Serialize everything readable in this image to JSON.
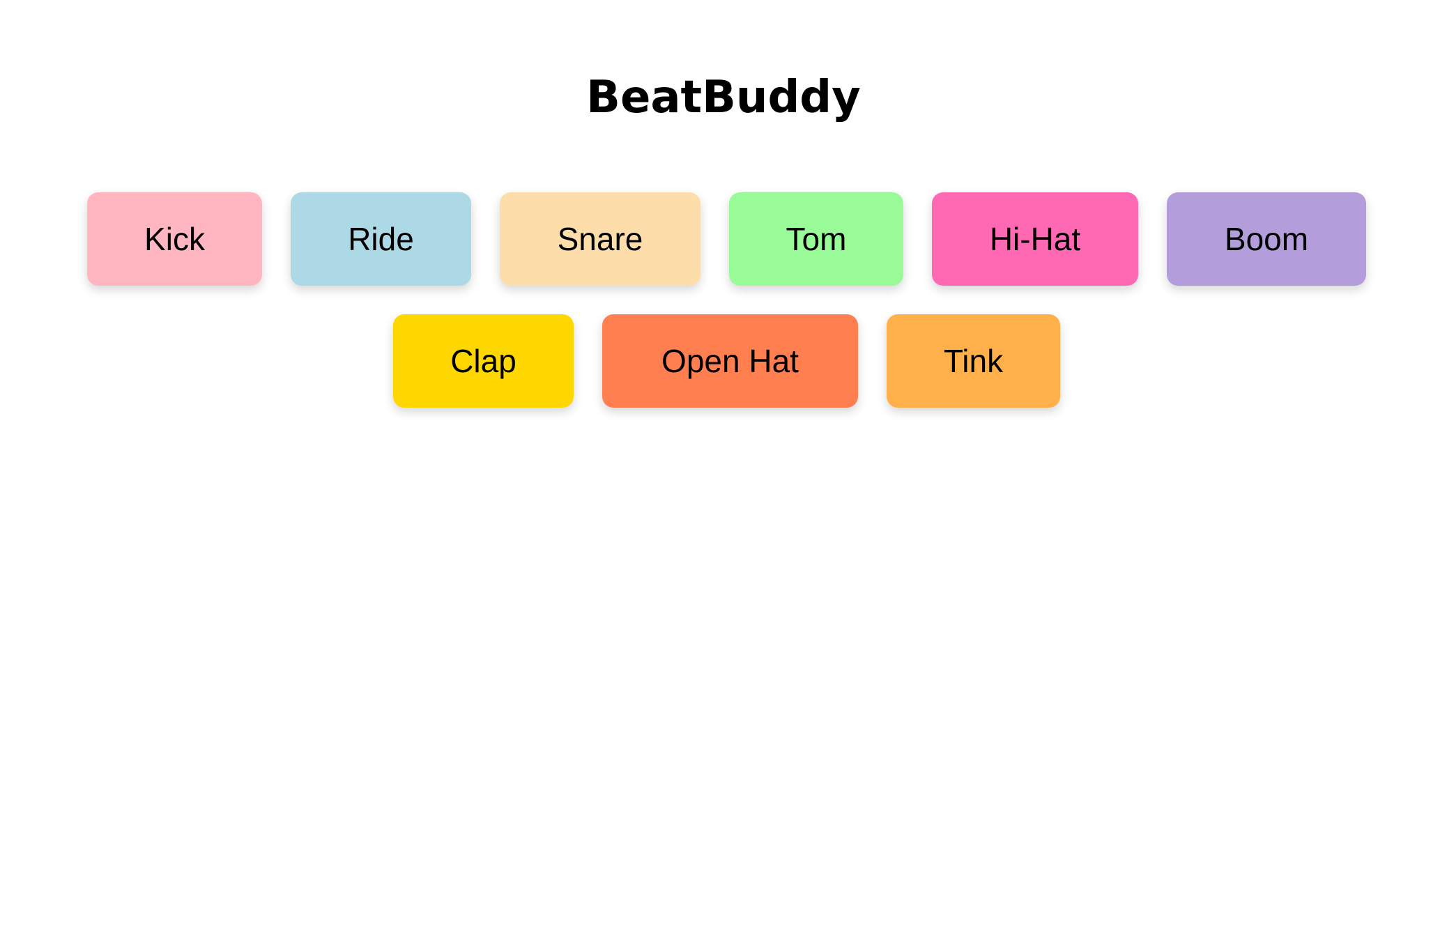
{
  "app": {
    "title": "BeatBuddy"
  },
  "pads": [
    {
      "id": "kick",
      "label": "Kick",
      "color": "#FFB6C1"
    },
    {
      "id": "ride",
      "label": "Ride",
      "color": "#ADD8E6"
    },
    {
      "id": "snare",
      "label": "Snare",
      "color": "#FDDEAB"
    },
    {
      "id": "tom",
      "label": "Tom",
      "color": "#98FB98"
    },
    {
      "id": "hihat",
      "label": "Hi-Hat",
      "color": "#FF69B4"
    },
    {
      "id": "boom",
      "label": "Boom",
      "color": "#B39DDB"
    },
    {
      "id": "clap",
      "label": "Clap",
      "color": "#FFD700"
    },
    {
      "id": "openhat",
      "label": "Open Hat",
      "color": "#FF7F50"
    },
    {
      "id": "tink",
      "label": "Tink",
      "color": "#FFB04A"
    }
  ]
}
